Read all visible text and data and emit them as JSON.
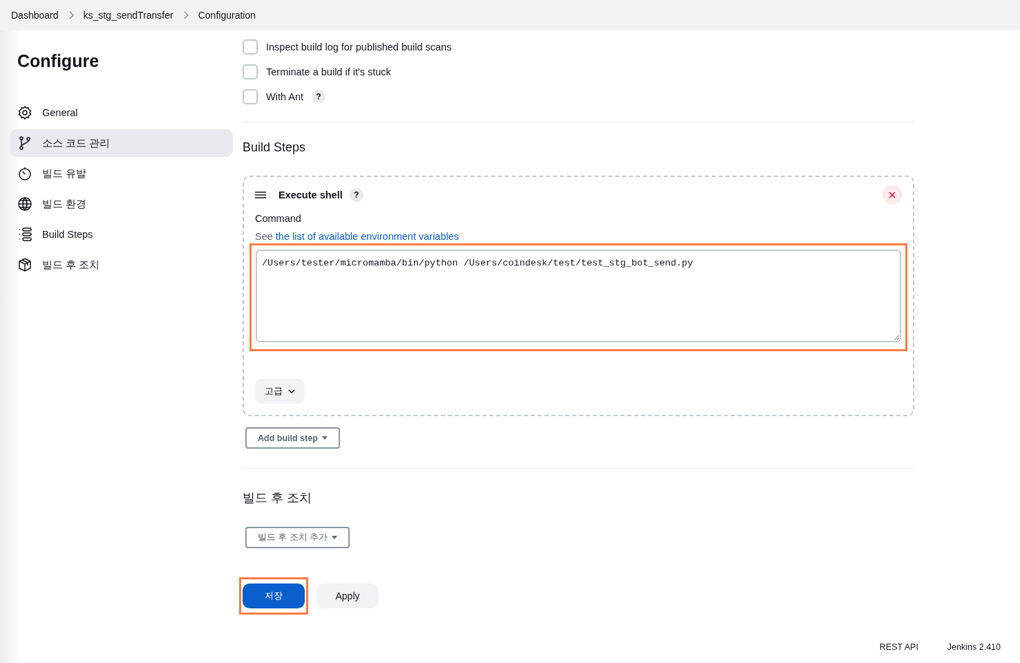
{
  "breadcrumbs": [
    {
      "label": "Dashboard"
    },
    {
      "label": "ks_stg_sendTransfer"
    },
    {
      "label": "Configuration"
    }
  ],
  "sidebar": {
    "title": "Configure",
    "items": [
      {
        "label": "General",
        "selected": false
      },
      {
        "label": "소스 코드 관리",
        "selected": true
      },
      {
        "label": "빌드 유발",
        "selected": false
      },
      {
        "label": "빌드 환경",
        "selected": false
      },
      {
        "label": "Build Steps",
        "selected": false
      },
      {
        "label": "빌드 후 조치",
        "selected": false
      }
    ]
  },
  "options": [
    {
      "label": "Inspect build log for published build scans",
      "checked": false
    },
    {
      "label": "Terminate a build if it's stuck",
      "checked": false
    },
    {
      "label": "With Ant",
      "checked": false,
      "help": "?"
    }
  ],
  "build_steps": {
    "title": "Build Steps",
    "step": {
      "title": "Execute shell",
      "help": "?",
      "command_label": "Command",
      "hint_prefix": "See",
      "hint_link": "the list of available environment variables",
      "command": "/Users/tester/micromamba/bin/python /Users/coindesk/test/test_stg_bot_send.py",
      "highlighted": true,
      "advanced": "고급"
    },
    "add_button": "Add build step"
  },
  "post_build": {
    "title": "빌드 후 조치",
    "add_button": "빌드 후 조치 추가"
  },
  "actions": {
    "save": "저장",
    "save_highlighted": true,
    "apply": "Apply"
  },
  "footer": [
    "REST API",
    "Jenkins 2.410"
  ]
}
